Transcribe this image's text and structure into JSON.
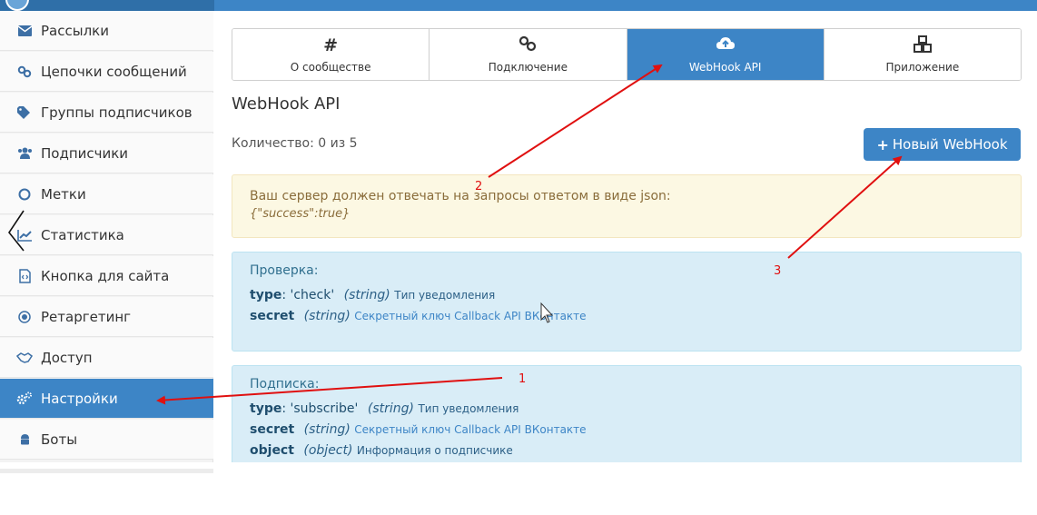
{
  "sidebar": {
    "items": [
      {
        "label": "Рассылки",
        "icon": "envelope-icon"
      },
      {
        "label": "Цепочки сообщений",
        "icon": "chain-link-icon"
      },
      {
        "label": "Группы подписчиков",
        "icon": "tag-icon"
      },
      {
        "label": "Подписчики",
        "icon": "users-icon"
      },
      {
        "label": "Метки",
        "icon": "circle-icon"
      },
      {
        "label": "Статистика",
        "icon": "line-chart-icon"
      },
      {
        "label": "Кнопка для сайта",
        "icon": "code-file-icon"
      },
      {
        "label": "Ретаргетинг",
        "icon": "target-icon"
      },
      {
        "label": "Доступ",
        "icon": "handshake-icon"
      },
      {
        "label": "Настройки",
        "icon": "cogs-icon",
        "active": true
      },
      {
        "label": "Боты",
        "icon": "android-icon"
      }
    ]
  },
  "tabs": [
    {
      "label": "О сообществе",
      "icon": "hash-icon",
      "glyph": "#"
    },
    {
      "label": "Подключение",
      "icon": "link-icon",
      "glyph": "⚯"
    },
    {
      "label": "WebHook API",
      "icon": "cloud-upload-icon",
      "glyph": "☁",
      "active": true
    },
    {
      "label": "Приложение",
      "icon": "cubes-icon",
      "glyph": "❖"
    }
  ],
  "main": {
    "title": "WebHook API",
    "count": "Количество: 0 из 5",
    "new_button_label": "Новый WebHook",
    "new_button_icon": "+"
  },
  "alert": {
    "text": "Ваш сервер должен отвечать на запросы ответом в виде json:",
    "json": "{\"success\":true}"
  },
  "check_box": {
    "title": "Проверка:",
    "lines": [
      {
        "key": "type",
        "value": ": 'check'",
        "type": "(string)",
        "desc": "Тип уведомления"
      },
      {
        "key": "secret",
        "value": "",
        "type": "(string)",
        "desc": "Секретный ключ Callback API ВКонтакте"
      }
    ]
  },
  "subscribe_box": {
    "title": "Подписка:",
    "lines": [
      {
        "key": "type",
        "value": ": 'subscribe'",
        "type": "(string)",
        "desc": "Тип уведомления"
      },
      {
        "key": "secret",
        "value": "",
        "type": "(string)",
        "desc": "Секретный ключ Callback API ВКонтакте"
      },
      {
        "key": "object",
        "value": "",
        "type": "(object)",
        "desc": "Информация о подписчике"
      }
    ]
  },
  "annotations": {
    "one": "1",
    "two": "2",
    "three": "3",
    "color": "#e01010"
  },
  "colors": {
    "accent": "#3d85c6",
    "warning_bg": "#fcf8e3",
    "info_bg": "#d9edf7"
  }
}
